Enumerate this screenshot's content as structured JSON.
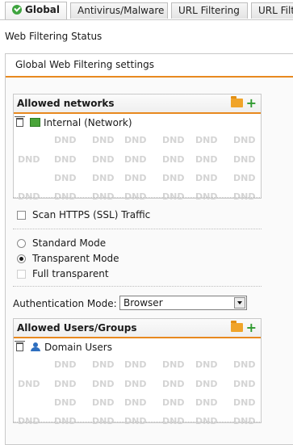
{
  "tabs": [
    {
      "label": "Global",
      "active": true,
      "icon": "check-icon"
    },
    {
      "label": "Antivirus/Malware"
    },
    {
      "label": "URL Filtering"
    },
    {
      "label": "URL Filt"
    }
  ],
  "status_title": "Web Filtering Status",
  "settings": {
    "header": "Global Web Filtering settings",
    "allowed_networks": {
      "title": "Allowed networks",
      "items": [
        {
          "label": "Internal (Network)",
          "icon": "network-icon"
        }
      ],
      "placeholder": "DND"
    },
    "scan_https_label": "Scan HTTPS (SSL) Traffic",
    "standard_mode_label": "Standard Mode",
    "transparent_mode_label": "Transparent Mode",
    "full_transparent_label": "Full transparent",
    "selected_mode": "Transparent Mode",
    "auth_mode_label": "Authentication Mode:",
    "auth_mode_value": "Browser",
    "allowed_users": {
      "title": "Allowed Users/Groups",
      "items": [
        {
          "label": "Domain Users",
          "icon": "users-icon"
        }
      ],
      "placeholder": "DND"
    }
  },
  "colors": {
    "accent": "#e8891f",
    "add_green": "#2f9a2f"
  }
}
